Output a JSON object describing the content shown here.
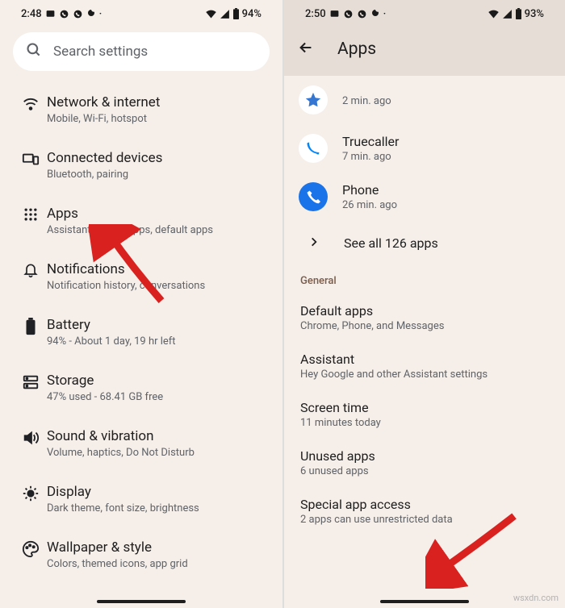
{
  "left": {
    "status": {
      "time": "2:48",
      "battery": "94%"
    },
    "search_placeholder": "Search settings",
    "items": [
      {
        "icon": "wifi",
        "title": "Network & internet",
        "sub": "Mobile, Wi-Fi, hotspot"
      },
      {
        "icon": "devices",
        "title": "Connected devices",
        "sub": "Bluetooth, pairing"
      },
      {
        "icon": "apps",
        "title": "Apps",
        "sub": "Assistant, recent apps, default apps"
      },
      {
        "icon": "bell",
        "title": "Notifications",
        "sub": "Notification history, conversations"
      },
      {
        "icon": "battery",
        "title": "Battery",
        "sub": "94% - About 1 day, 19 hr left"
      },
      {
        "icon": "storage",
        "title": "Storage",
        "sub": "47% used - 68.41 GB free"
      },
      {
        "icon": "sound",
        "title": "Sound & vibration",
        "sub": "Volume, haptics, Do Not Disturb"
      },
      {
        "icon": "display",
        "title": "Display",
        "sub": "Dark theme, font size, brightness"
      },
      {
        "icon": "wallpaper",
        "title": "Wallpaper & style",
        "sub": "Colors, themed icons, app grid"
      }
    ]
  },
  "right": {
    "status": {
      "time": "2:50",
      "battery": "93%"
    },
    "header": "Apps",
    "recent": [
      {
        "name": "",
        "sub": "2 min. ago",
        "icon": "generic"
      },
      {
        "name": "Truecaller",
        "sub": "7 min. ago",
        "icon": "truecaller"
      },
      {
        "name": "Phone",
        "sub": "26 min. ago",
        "icon": "phone"
      }
    ],
    "see_all": "See all 126 apps",
    "section": "General",
    "general": [
      {
        "title": "Default apps",
        "sub": "Chrome, Phone, and Messages"
      },
      {
        "title": "Assistant",
        "sub": "Hey Google and other Assistant settings"
      },
      {
        "title": "Screen time",
        "sub": "11 minutes today"
      },
      {
        "title": "Unused apps",
        "sub": "6 unused apps"
      },
      {
        "title": "Special app access",
        "sub": "2 apps can use unrestricted data"
      }
    ]
  },
  "watermark": "wsxdn.com"
}
